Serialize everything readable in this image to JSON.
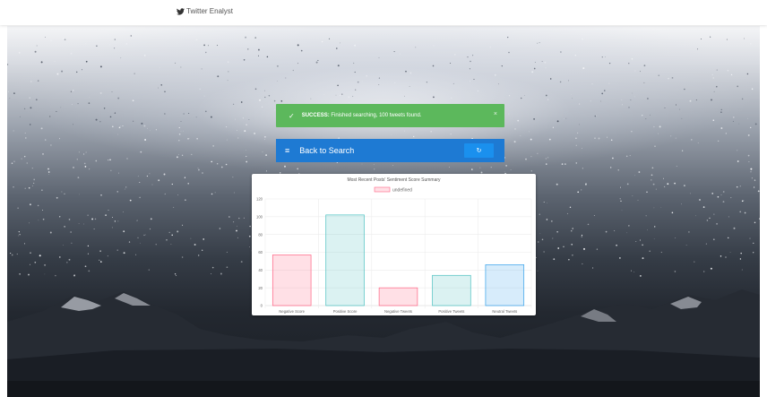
{
  "navbar": {
    "brand": "Twitter Enalyst",
    "brand_icon": "twitter-bird-icon"
  },
  "alert": {
    "strong": "SUCCESS:",
    "message": " Finished searching, 100 tweets found.",
    "close": "×",
    "color": "#5cb85c"
  },
  "back": {
    "label": "Back to Search",
    "menu_icon": "≡",
    "refresh_icon": "↻",
    "color": "#1e7ad3"
  },
  "chart_data": {
    "type": "bar",
    "title": "Most Recent Posts' Sentiment Score Summary",
    "legend": {
      "label": "undefined",
      "position": "top"
    },
    "categories": [
      "Negative Score",
      "Positive Score",
      "Negative Tweets",
      "Positive Tweets",
      "Neutral Tweets"
    ],
    "values": [
      57,
      102,
      20,
      34,
      46
    ],
    "ylim": [
      0,
      120
    ],
    "yticks": [
      0,
      20,
      40,
      60,
      80,
      100,
      120
    ],
    "grid": true,
    "fill_colors": [
      "rgba(255,99,132,0.2)",
      "rgba(75,192,192,0.2)",
      "rgba(255,99,132,0.2)",
      "rgba(75,192,192,0.2)",
      "rgba(54,162,235,0.2)"
    ],
    "border_colors": [
      "#ff6384",
      "#4bc0c0",
      "#ff6384",
      "#4bc0c0",
      "#36a2eb"
    ]
  }
}
